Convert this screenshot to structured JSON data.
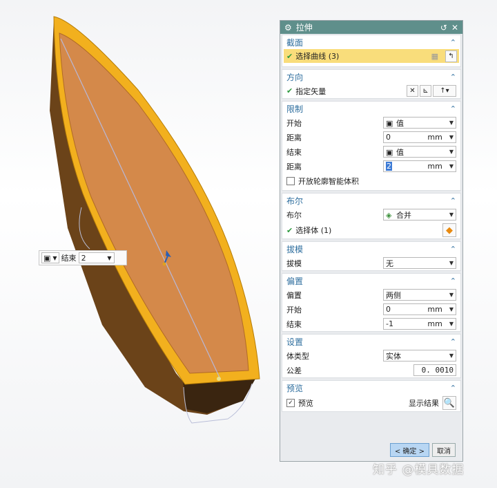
{
  "handle": {
    "type_icon": "cube-icon",
    "label": "结束",
    "value": "2"
  },
  "dialog": {
    "title": "拉伸",
    "sections": {
      "section": {
        "title": "截面",
        "select_curve": "选择曲线 (3)"
      },
      "direction": {
        "title": "方向",
        "vector_label": "指定矢量"
      },
      "limits": {
        "title": "限制",
        "start_label": "开始",
        "start_value": "值",
        "dist1_label": "距离",
        "dist1_value": "0",
        "dist1_unit": "mm",
        "end_label": "结束",
        "end_value": "值",
        "dist2_label": "距离",
        "dist2_value": "2",
        "dist2_unit": "mm",
        "open_profile": "开放轮廓智能体积"
      },
      "boolean": {
        "title": "布尔",
        "bool_label": "布尔",
        "bool_value": "合并",
        "select_body": "选择体 (1)"
      },
      "draft": {
        "title": "拔模",
        "draft_label": "拔模",
        "draft_value": "无"
      },
      "offset": {
        "title": "偏置",
        "offset_label": "偏置",
        "offset_value": "两侧",
        "start_label": "开始",
        "start_value": "0",
        "start_unit": "mm",
        "end_label": "结束",
        "end_value": "-1",
        "end_unit": "mm"
      },
      "settings": {
        "title": "设置",
        "body_type_label": "体类型",
        "body_type_value": "实体",
        "tolerance_label": "公差",
        "tolerance_value": "0. 0010"
      },
      "preview": {
        "title": "预览",
        "preview_label": "预览",
        "show_result": "显示结果"
      }
    },
    "ok_label": "< 确定 >",
    "cancel_label": "取消"
  },
  "watermark": "知乎 @模具数据",
  "colors": {
    "titlebar": "#5f8f8b",
    "section_title": "#2e6e9e",
    "selection": "#f9dd7b",
    "boat_inner": "#d4894a",
    "boat_rim": "#f2b01e"
  }
}
